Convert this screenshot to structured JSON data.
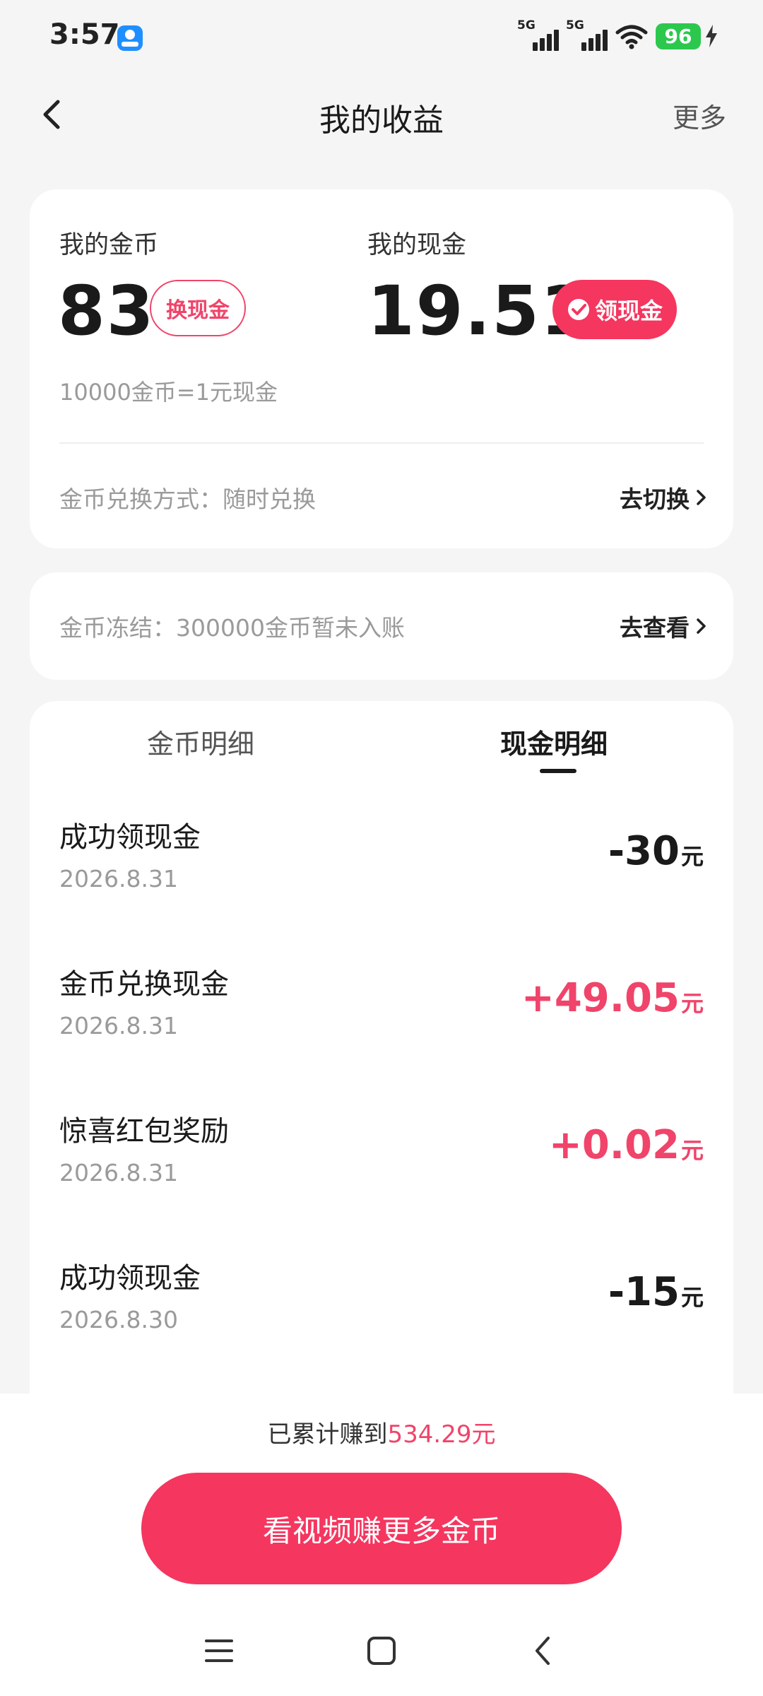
{
  "status_bar": {
    "time": "3:57",
    "network_1": "5G",
    "network_2": "5G",
    "battery": "96"
  },
  "nav": {
    "title": "我的收益",
    "more_label": "更多"
  },
  "balance": {
    "coins_label": "我的金币",
    "coins_value": "83",
    "exchange_button": "换现金",
    "cash_label": "我的现金",
    "cash_value": "19.51",
    "withdraw_button": "领现金",
    "rate_text": "10000金币=1元现金",
    "exchange_method_label": "金币兑换方式：随时兑换",
    "switch_link": "去切换"
  },
  "frozen": {
    "label": "金币冻结：300000金币暂未入账",
    "view_link": "去查看"
  },
  "tabs": [
    {
      "label": "金币明细",
      "active": false
    },
    {
      "label": "现金明细",
      "active": true
    }
  ],
  "transactions": [
    {
      "title": "成功领现金",
      "date": "2026.8.31",
      "amount": "-30",
      "unit": "元",
      "positive": false
    },
    {
      "title": "金币兑换现金",
      "date": "2026.8.31",
      "amount": "+49.05",
      "unit": "元",
      "positive": true
    },
    {
      "title": "惊喜红包奖励",
      "date": "2026.8.31",
      "amount": "+0.02",
      "unit": "元",
      "positive": true
    },
    {
      "title": "成功领现金",
      "date": "2026.8.30",
      "amount": "-15",
      "unit": "元",
      "positive": false
    }
  ],
  "footer": {
    "total_prefix": "已累计赚到",
    "total_amount": "534.29元",
    "cta_label": "看视频赚更多金币"
  },
  "colors": {
    "accent": "#f5365f",
    "accent_text": "#f0446a",
    "background": "#f5f5f5",
    "card": "#ffffff"
  },
  "icons": {
    "back": "chevron-left-icon",
    "withdraw": "wechat-icon",
    "link_arrow": "chevron-right-icon",
    "menu": "menu-icon",
    "home": "home-square-icon",
    "sys_back": "back-icon"
  }
}
